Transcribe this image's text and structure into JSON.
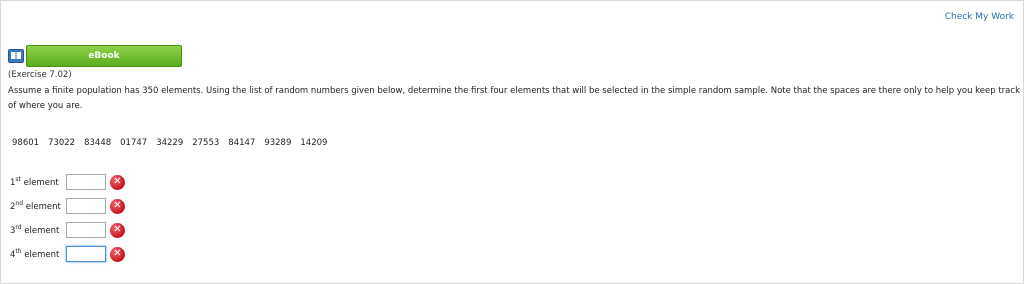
{
  "header": {
    "check_my_work": "Check My Work"
  },
  "ebook": {
    "label": "eBook"
  },
  "exercise": {
    "reference": "(Exercise 7.02)",
    "question": "Assume a finite population has 350 elements. Using the list of random numbers given below, determine the first four elements that will be selected in the simple random sample. Note that the spaces are there only to help you keep track of where you are."
  },
  "random_numbers": [
    "98601",
    "73022",
    "83448",
    "01747",
    "34229",
    "27553",
    "84147",
    "93289",
    "14209"
  ],
  "answers": [
    {
      "num": "1",
      "suffix": "st",
      "word": "element",
      "value": "",
      "status_icon": "incorrect-x"
    },
    {
      "num": "2",
      "suffix": "nd",
      "word": "element",
      "value": "",
      "status_icon": "incorrect-x"
    },
    {
      "num": "3",
      "suffix": "rd",
      "word": "element",
      "value": "",
      "status_icon": "incorrect-x"
    },
    {
      "num": "4",
      "suffix": "th",
      "word": "element",
      "value": "",
      "status_icon": "incorrect-x"
    }
  ],
  "colors": {
    "accent_green": "#6cbf2a",
    "link_blue": "#2a6fb0",
    "error_red": "#c8161d"
  }
}
